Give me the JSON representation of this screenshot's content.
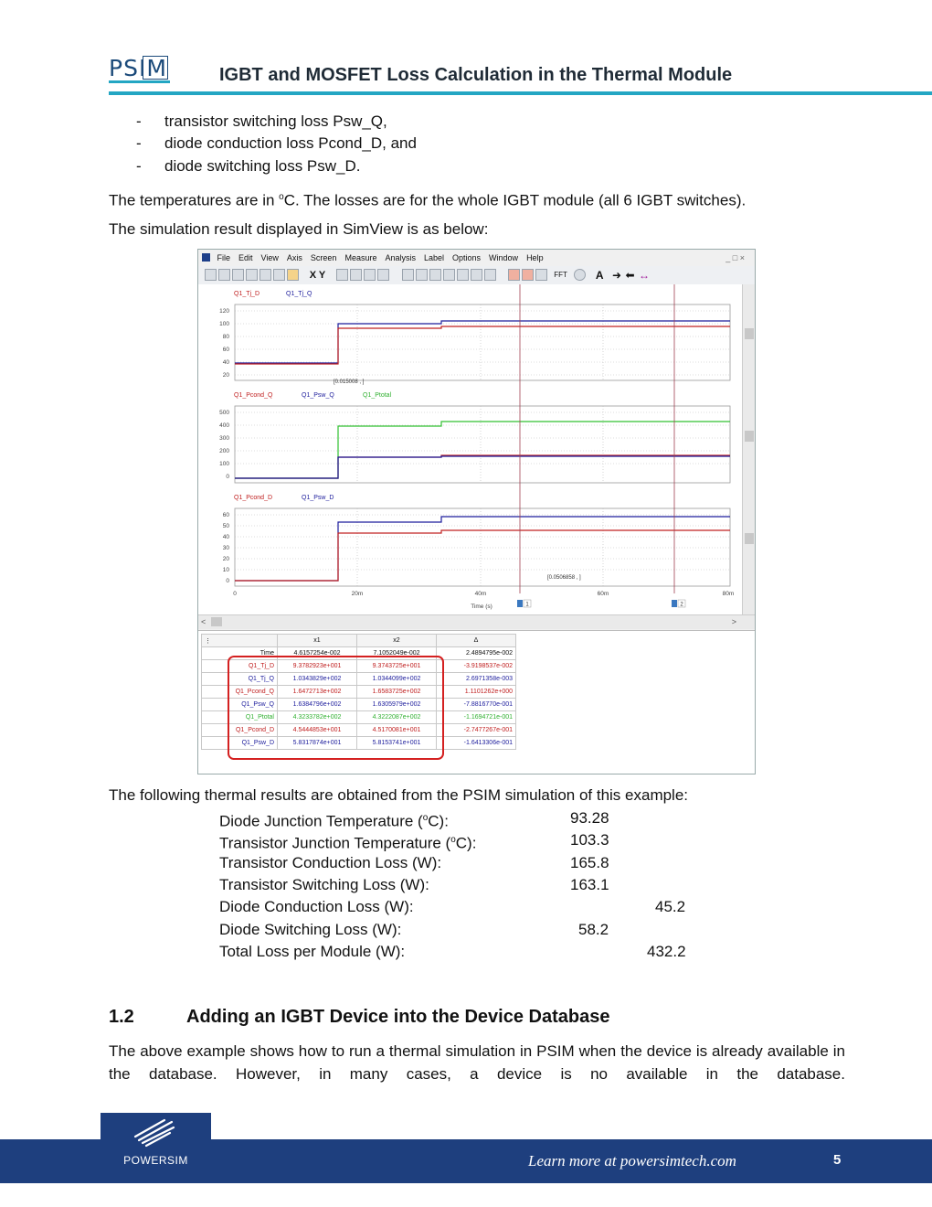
{
  "header": {
    "logo": "PSIM",
    "title": "IGBT and MOSFET Loss Calculation in the Thermal Module"
  },
  "bullets": [
    {
      "dash": "-",
      "text": "transistor switching loss Psw_Q,"
    },
    {
      "dash": "-",
      "text": "diode conduction loss Pcond_D, and"
    },
    {
      "dash": "-",
      "text": "diode switching loss Psw_D."
    }
  ],
  "temps_sentence": {
    "pre": "The temperatures are in ",
    "sup": "o",
    "post": "C. The losses are for the whole IGBT module (all 6 IGBT switches)."
  },
  "simview_sentence": "The simulation result displayed in SimView is as below:",
  "simview": {
    "menu": [
      "File",
      "Edit",
      "View",
      "Axis",
      "Screen",
      "Measure",
      "Analysis",
      "Label",
      "Options",
      "Window",
      "Help"
    ],
    "toolbar_text": {
      "xy": "X Y",
      "fft": "FFT",
      "a": "A"
    },
    "plot1": {
      "legend": [
        "Q1_Tj_D",
        "Q1_Tj_Q"
      ],
      "yticks": [
        "120",
        "100",
        "80",
        "60",
        "40",
        "20"
      ],
      "marker": "[0.015008 , ]"
    },
    "plot2": {
      "legend": [
        "Q1_Pcond_Q",
        "Q1_Psw_Q",
        "Q1_Ptotal"
      ],
      "yticks": [
        "500",
        "400",
        "300",
        "200",
        "100",
        "0"
      ]
    },
    "plot3": {
      "legend": [
        "Q1_Pcond_D",
        "Q1_Psw_D"
      ],
      "yticks": [
        "60",
        "50",
        "40",
        "30",
        "20",
        "10",
        "0"
      ],
      "marker": "[0.0506858 , ]"
    },
    "xticks": [
      "0",
      "20m",
      "40m",
      "60m",
      "80m"
    ],
    "xlabel": "Time (s)",
    "cursor_labels": [
      "1",
      "2"
    ],
    "colors": {
      "blue": "#1c1c9c",
      "red": "#c02020",
      "purple": "#6a1a7a",
      "green": "#30c030",
      "cursor": "#a04050"
    },
    "table": {
      "headers": [
        "x1",
        "x2",
        "Δ"
      ],
      "rows": [
        {
          "name": "Time",
          "x1": "4.6157254e-002",
          "x2": "7.1052049e-002",
          "d": "2.4894795e-002",
          "color": "#222222"
        },
        {
          "name": "Q1_Tj_D",
          "x1": "9.3782923e+001",
          "x2": "9.3743725e+001",
          "d": "-3.9198537e-002",
          "color": "#c02020"
        },
        {
          "name": "Q1_Tj_Q",
          "x1": "1.0343829e+002",
          "x2": "1.0344099e+002",
          "d": "2.6971358e-003",
          "color": "#1c1c9c"
        },
        {
          "name": "Q1_Pcond_Q",
          "x1": "1.6472713e+002",
          "x2": "1.6583725e+002",
          "d": "1.1101262e+000",
          "color": "#c02020"
        },
        {
          "name": "Q1_Psw_Q",
          "x1": "1.6384796e+002",
          "x2": "1.6305979e+002",
          "d": "-7.8816770e-001",
          "color": "#1c1c9c"
        },
        {
          "name": "Q1_Ptotal",
          "x1": "4.3233782e+002",
          "x2": "4.3222087e+002",
          "d": "-1.1694721e-001",
          "color": "#30b030"
        },
        {
          "name": "Q1_Pcond_D",
          "x1": "4.5444853e+001",
          "x2": "4.5170081e+001",
          "d": "-2.7477267e-001",
          "color": "#c02020"
        },
        {
          "name": "Q1_Psw_D",
          "x1": "5.8317874e+001",
          "x2": "5.8153741e+001",
          "d": "-1.6413306e-001",
          "color": "#1c1c9c"
        }
      ]
    }
  },
  "results_intro": "The following thermal results are obtained from the PSIM simulation of this example:",
  "results": [
    {
      "label": "Diode Junction Temperature (",
      "sup": "o",
      "label_end": "C):",
      "value": "93.28"
    },
    {
      "label": "Transistor Junction Temperature (",
      "sup": "o",
      "label_end": "C):",
      "value": "103.3"
    },
    {
      "label": "Transistor Conduction Loss (W):",
      "sup": "",
      "label_end": "",
      "value": "165.8"
    },
    {
      "label": "Transistor Switching Loss (W):",
      "sup": "",
      "label_end": "",
      "value": "163.1"
    },
    {
      "label": "Diode Conduction Loss (W):",
      "sup": "",
      "label_end": "",
      "value": "45.2"
    },
    {
      "label": "Diode Switching Loss (W):",
      "sup": "",
      "label_end": "",
      "value": "58.2"
    },
    {
      "label": "Total Loss per Module (W):",
      "sup": "",
      "label_end": "",
      "value": "432.2"
    }
  ],
  "section": {
    "number": "1.2",
    "title": "Adding an IGBT Device into the Device Database",
    "paragraph": "The above example shows how to run a thermal simulation in PSIM when the device is already available in the database. However, in many cases, a device is no available in the database."
  },
  "footer": {
    "brand": "POWERSIM",
    "link": "Learn more at powersimtech.com",
    "page": "5"
  }
}
